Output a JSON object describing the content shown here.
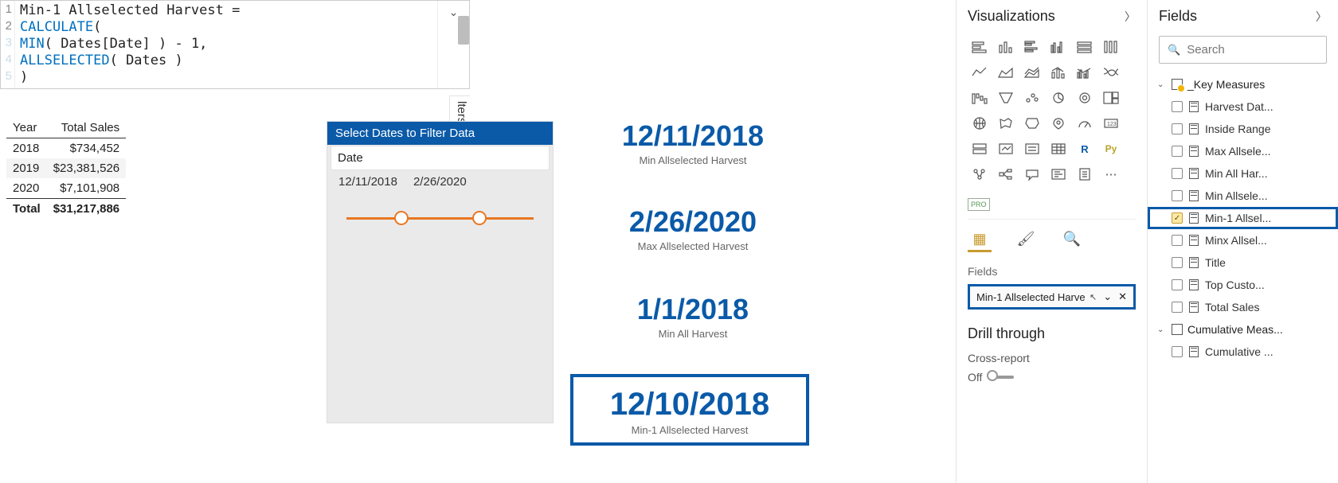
{
  "formula": {
    "line_numbers": [
      "1",
      "2",
      "3",
      "4",
      "5"
    ],
    "l1_a": "Min-1 Allselected Harvest = ",
    "l2_kw": "CALCULATE",
    "l2_b": "(",
    "l3_a": "    ",
    "l3_kw": "MIN",
    "l3_b": "( Dates[Date] ) - 1,",
    "l4_a": "    ",
    "l4_kw": "ALLSELECTED",
    "l4_b": "( Dates )",
    "l5": ")"
  },
  "filters_tab": "lters",
  "sales_table": {
    "headers": [
      "Year",
      "Total Sales"
    ],
    "rows": [
      {
        "year": "2018",
        "total": "$734,452"
      },
      {
        "year": "2019",
        "total": "$23,381,526"
      },
      {
        "year": "2020",
        "total": "$7,101,908"
      }
    ],
    "total_label": "Total",
    "total_value": "$31,217,886"
  },
  "slicer": {
    "title": "Select Dates to Filter Data",
    "field": "Date",
    "start": "12/11/2018",
    "end": "2/26/2020"
  },
  "cards": [
    {
      "value": "12/11/2018",
      "label": "Min Allselected Harvest"
    },
    {
      "value": "2/26/2020",
      "label": "Max Allselected Harvest"
    },
    {
      "value": "1/1/2018",
      "label": "Min All Harvest"
    },
    {
      "value": "12/10/2018",
      "label": "Min-1 Allselected Harvest"
    }
  ],
  "viz_panel": {
    "title": "Visualizations",
    "fields_label": "Fields",
    "field_well": "Min-1 Allselected Harve",
    "drill_title": "Drill through",
    "cross_report": "Cross-report",
    "toggle_state": "Off"
  },
  "fields_panel": {
    "title": "Fields",
    "search_placeholder": "Search",
    "tables": [
      {
        "name": "_Key Measures",
        "expanded": true,
        "warn": true,
        "fields": [
          {
            "label": "Harvest Dat...",
            "checked": false
          },
          {
            "label": "Inside Range",
            "checked": false
          },
          {
            "label": "Max Allsele...",
            "checked": false
          },
          {
            "label": "Min All Har...",
            "checked": false
          },
          {
            "label": "Min Allsele...",
            "checked": false
          },
          {
            "label": "Min-1 Allsel...",
            "checked": true,
            "highlight": true
          },
          {
            "label": "Minx Allsel...",
            "checked": false
          },
          {
            "label": "Title",
            "checked": false
          },
          {
            "label": "Top Custo...",
            "checked": false
          },
          {
            "label": "Total Sales",
            "checked": false
          }
        ]
      },
      {
        "name": "Cumulative Meas...",
        "expanded": true,
        "warn": false,
        "fields": [
          {
            "label": "Cumulative ...",
            "checked": false
          }
        ]
      }
    ]
  }
}
